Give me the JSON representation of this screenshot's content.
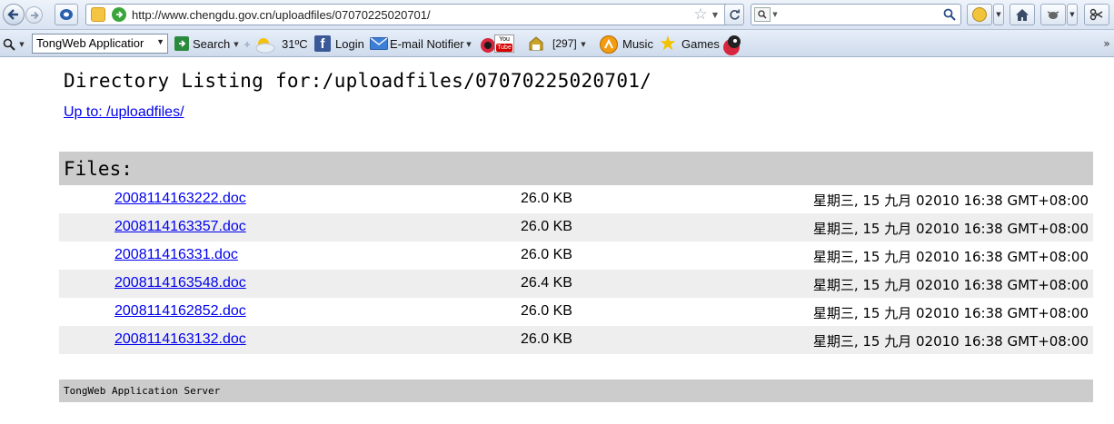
{
  "browser": {
    "url": "http://www.chengdu.gov.cn/uploadfiles/07070225020701/",
    "toolbar": {
      "dropdown_value": "TongWeb Applicatior",
      "search_label": "Search",
      "weather": "31ºC",
      "login_label": "Login",
      "email_label": "E-mail Notifier",
      "youtube_label": "You Tube",
      "count_badge": "[297]",
      "music_label": "Music",
      "games_label": "Games"
    },
    "icons": {
      "back": "back-arrow-icon",
      "forward": "forward-arrow-icon",
      "go": "go-icon"
    }
  },
  "page": {
    "title": "Directory Listing for:/uploadfiles/07070225020701/",
    "up_link": "Up to: /uploadfiles/",
    "files_heading": "Files:",
    "files": [
      {
        "name": "2008114163222.doc",
        "size": "26.0 KB",
        "date": "星期三, 15 九月 02010 16:38 GMT+08:00"
      },
      {
        "name": "2008114163357.doc",
        "size": "26.0 KB",
        "date": "星期三, 15 九月 02010 16:38 GMT+08:00"
      },
      {
        "name": "200811416331.doc",
        "size": "26.0 KB",
        "date": "星期三, 15 九月 02010 16:38 GMT+08:00"
      },
      {
        "name": "2008114163548.doc",
        "size": "26.4 KB",
        "date": "星期三, 15 九月 02010 16:38 GMT+08:00"
      },
      {
        "name": "2008114162852.doc",
        "size": "26.0 KB",
        "date": "星期三, 15 九月 02010 16:38 GMT+08:00"
      },
      {
        "name": "2008114163132.doc",
        "size": "26.0 KB",
        "date": "星期三, 15 九月 02010 16:38 GMT+08:00"
      }
    ],
    "footer": "TongWeb Application Server"
  }
}
